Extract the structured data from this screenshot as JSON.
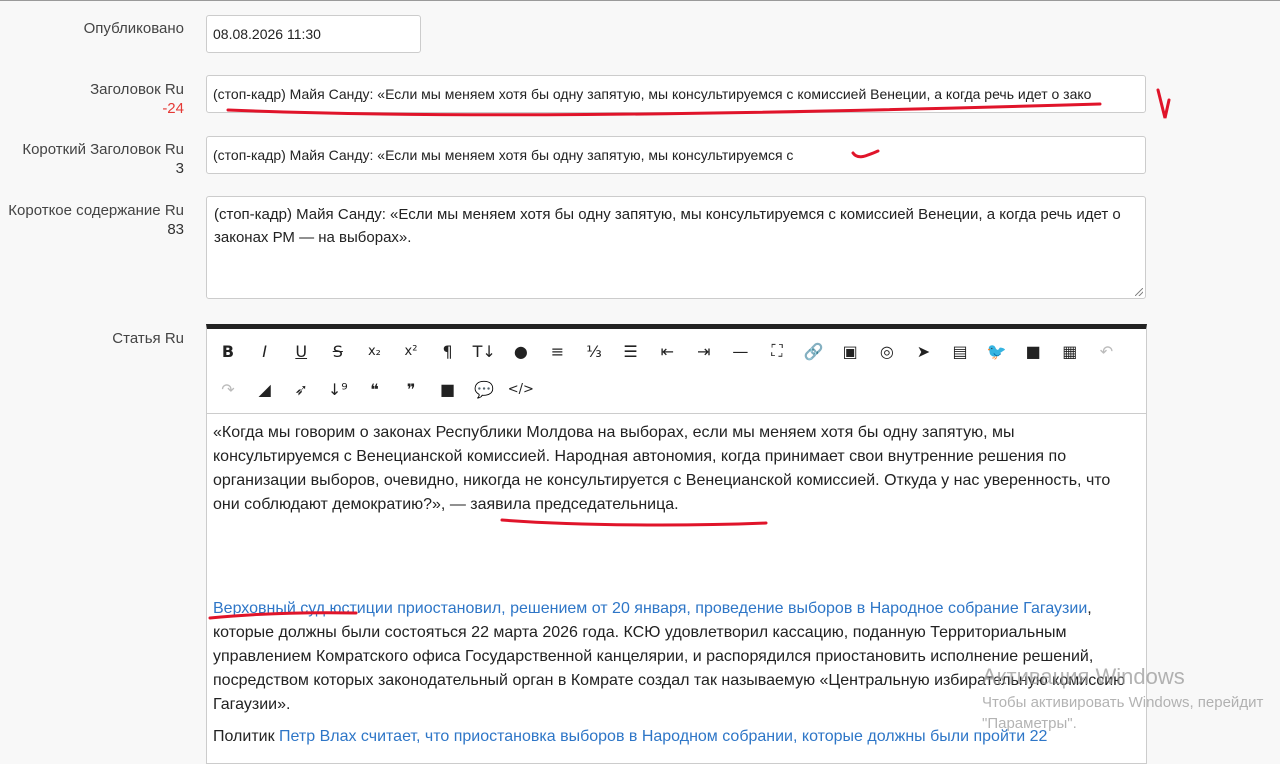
{
  "published": {
    "label": "Опубликовано",
    "value": "08.08.2026 11:30"
  },
  "title_ru": {
    "label": "Заголовок Ru",
    "count": "-24",
    "value": "(стоп-кадр) Майя Санду: «Если мы меняем хотя бы одну запятую, мы консультируемся с комиссией Венеции, а когда речь идет о зако"
  },
  "short_title_ru": {
    "label": "Короткий Заголовок Ru",
    "count": "3",
    "value": "(стоп-кадр) Майя Санду: «Если мы меняем хотя бы одну запятую, мы консультируемся с"
  },
  "short_content_ru": {
    "label": "Короткое содержание Ru",
    "count": "83",
    "value": "(стоп-кадр) Майя Санду: «Если мы меняем хотя бы одну запятую, мы консультируемся с комиссией Венеции, а когда речь идет о законах РМ — на выборах»."
  },
  "article_ru": {
    "label": "Статья Ru",
    "p1": "«Когда мы говорим о законах Республики Молдова на выборах, если мы меняем хотя бы одну запятую, мы консультируемся с Венецианской комиссией. Народная автономия, когда принимает свои внутренние решения по организации выборов, очевидно, никогда не консультируется с Венецианской комиссией. Откуда у нас уверенность, что они соблюдают демократию?», — заявила председательница.",
    "p2_link": "Верховный суд юстиции приостановил, решением от 20 января, проведение выборов в Народное собрание Гагаузии",
    "p2_text": ", которые должны были состояться 22 марта 2026 года. КСЮ удовлетворил кассацию, поданную Территориальным управлением Комратского офиса Государственной канцелярии, и распорядился приостановить исполнение решений, посредством которых законодательный орган в Комрате создал так называемую «Центральную избирательную комиссию Гагаузии».",
    "p3_text": "Политик ",
    "p3_link": "Петр Влах считает, что приостановка выборов в Народном собрании, которые должны были пройти 22"
  },
  "toolbar_icons": [
    {
      "name": "bold-icon",
      "glyph": "B"
    },
    {
      "name": "italic-icon",
      "glyph": "I"
    },
    {
      "name": "underline-icon",
      "glyph": "U"
    },
    {
      "name": "strikethrough-icon",
      "glyph": "S"
    },
    {
      "name": "subscript-icon",
      "glyph": "x₂"
    },
    {
      "name": "superscript-icon",
      "glyph": "x²"
    },
    {
      "name": "paragraph-icon",
      "glyph": "¶"
    },
    {
      "name": "text-height-icon",
      "glyph": "T↓"
    },
    {
      "name": "color-drop-icon",
      "glyph": "●"
    },
    {
      "name": "align-icon",
      "glyph": "≡"
    },
    {
      "name": "ordered-list-icon",
      "glyph": "⅓"
    },
    {
      "name": "unordered-list-icon",
      "glyph": "☰"
    },
    {
      "name": "outdent-icon",
      "glyph": "⇤"
    },
    {
      "name": "indent-icon",
      "glyph": "⇥"
    },
    {
      "name": "horizontal-rule-icon",
      "glyph": "—"
    },
    {
      "name": "fullscreen-icon",
      "glyph": "⛶"
    },
    {
      "name": "link-icon",
      "glyph": "🔗"
    },
    {
      "name": "image-icon",
      "glyph": "▣"
    },
    {
      "name": "instagram-icon",
      "glyph": "◎"
    },
    {
      "name": "telegram-icon",
      "glyph": "➤"
    },
    {
      "name": "file-icon",
      "glyph": "▤"
    },
    {
      "name": "twitter-icon",
      "glyph": "🐦"
    },
    {
      "name": "video-icon",
      "glyph": "■"
    },
    {
      "name": "table-icon",
      "glyph": "▦"
    },
    {
      "name": "undo-icon",
      "glyph": "↶"
    },
    {
      "name": "redo-icon",
      "glyph": "↷"
    },
    {
      "name": "eraser-icon",
      "glyph": "◢"
    },
    {
      "name": "cursor-icon",
      "glyph": "➶"
    },
    {
      "name": "sort-numeric-icon",
      "glyph": "↓⁹"
    },
    {
      "name": "quote-left-icon",
      "glyph": "❝"
    },
    {
      "name": "quote-right-icon",
      "glyph": "❞"
    },
    {
      "name": "stop-icon",
      "glyph": "■"
    },
    {
      "name": "comment-icon",
      "glyph": "💬"
    },
    {
      "name": "code-icon",
      "glyph": "</>"
    }
  ],
  "watermark": {
    "line1": "Активация Windows",
    "line2": "Чтобы активировать Windows, перейдит",
    "line3": "\"Параметры\"."
  },
  "colors": {
    "link": "#2e76c7",
    "count_negative": "#e53935",
    "annotation": "#e0142a"
  }
}
